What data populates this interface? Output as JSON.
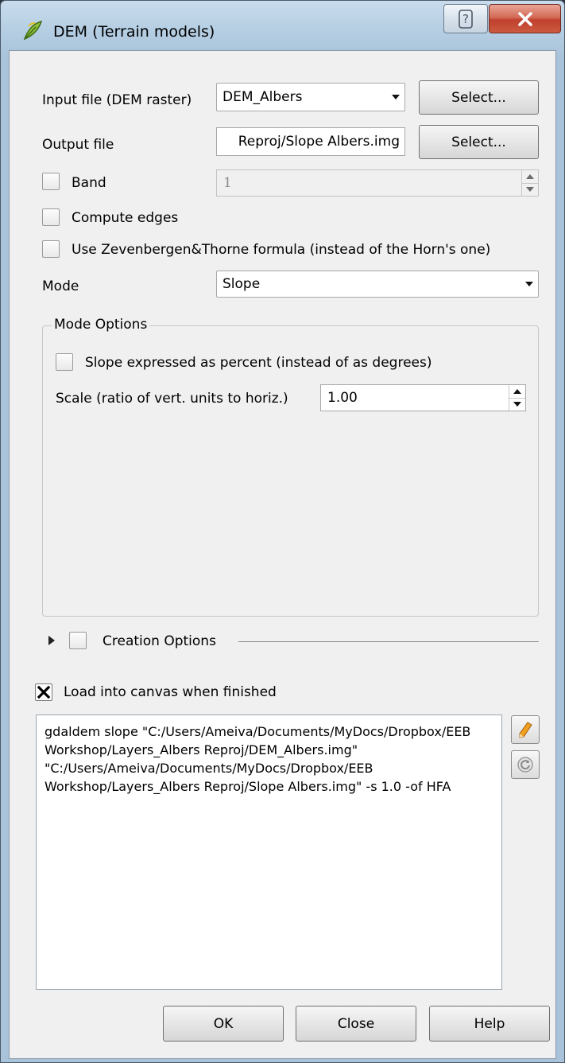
{
  "window": {
    "title": "DEM (Terrain models)"
  },
  "titlebar": {
    "help_glyph": "?",
    "close_glyph": "X"
  },
  "form": {
    "input_label": "Input file (DEM raster)",
    "input_value": "DEM_Albers",
    "input_select": "Select...",
    "output_label": "Output file",
    "output_value": "Reproj/Slope Albers.img",
    "output_select": "Select...",
    "band_label": "Band",
    "band_value": "1",
    "compute_edges_label": "Compute edges",
    "zt_label": "Use Zevenbergen&Thorne formula (instead of the Horn's one)",
    "mode_label": "Mode",
    "mode_value": "Slope"
  },
  "mode_options": {
    "legend": "Mode Options",
    "percent_label": "Slope expressed as percent (instead of as degrees)",
    "scale_label": "Scale (ratio of vert. units to horiz.)",
    "scale_value": "1.00"
  },
  "creation_options": {
    "label": "Creation Options"
  },
  "load_canvas": {
    "label": "Load into canvas when finished",
    "checked": true
  },
  "command": {
    "text": "gdaldem slope \"C:/Users/Ameiva/Documents/MyDocs/Dropbox/EEB Workshop/Layers_Albers Reproj/DEM_Albers.img\" \"C:/Users/Ameiva/Documents/MyDocs/Dropbox/EEB Workshop/Layers_Albers Reproj/Slope Albers.img\" -s 1.0 -of HFA"
  },
  "buttons": {
    "ok": "OK",
    "close": "Close",
    "help": "Help"
  },
  "colors": {
    "titlebar": "#b4cde2",
    "close_red": "#c0402c",
    "client_bg": "#f0f0f0"
  },
  "icons": {
    "app": "qgis-leaf-icon",
    "edit": "pencil-icon",
    "reset": "reset-icon"
  }
}
